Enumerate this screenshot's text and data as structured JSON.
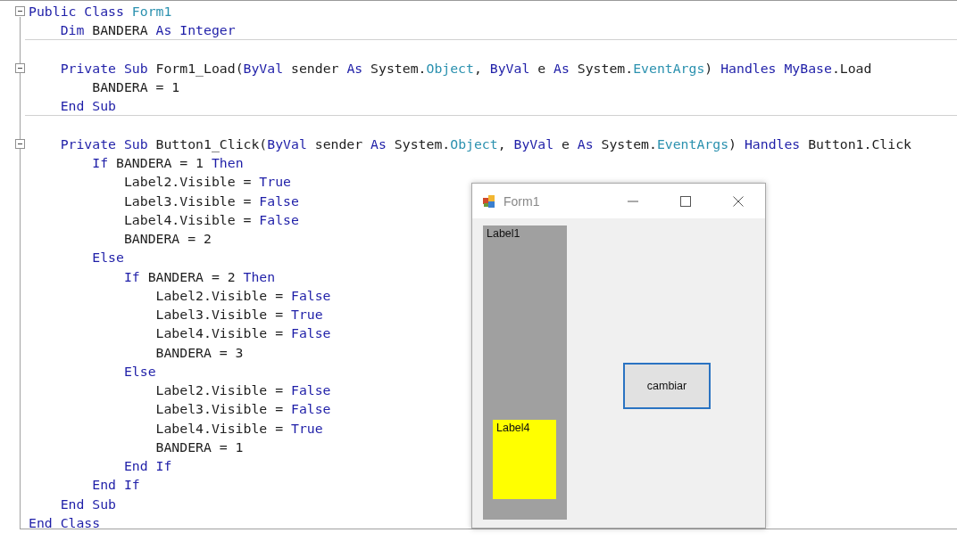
{
  "code_lines": [
    {
      "kind": "code",
      "expanded": true,
      "tokens": [
        {
          "kind": "kw",
          "text": "Public Class "
        },
        {
          "kind": "type",
          "text": "Form1"
        }
      ]
    },
    {
      "kind": "code",
      "separator_after": true,
      "tokens": [
        {
          "kind": "kw",
          "text": "    Dim"
        },
        {
          "kind": "plain",
          "text": " BANDERA "
        },
        {
          "kind": "kw",
          "text": "As Integer"
        }
      ]
    },
    {
      "kind": "blank"
    },
    {
      "kind": "code",
      "expanded": true,
      "tokens": [
        {
          "kind": "kw",
          "text": "    Private Sub"
        },
        {
          "kind": "plain",
          "text": " Form1_Load("
        },
        {
          "kind": "kw",
          "text": "ByVal"
        },
        {
          "kind": "plain",
          "text": " sender "
        },
        {
          "kind": "kw",
          "text": "As"
        },
        {
          "kind": "plain",
          "text": " System."
        },
        {
          "kind": "type",
          "text": "Object"
        },
        {
          "kind": "plain",
          "text": ", "
        },
        {
          "kind": "kw",
          "text": "ByVal"
        },
        {
          "kind": "plain",
          "text": " e "
        },
        {
          "kind": "kw",
          "text": "As"
        },
        {
          "kind": "plain",
          "text": " System."
        },
        {
          "kind": "type",
          "text": "EventArgs"
        },
        {
          "kind": "plain",
          "text": ") "
        },
        {
          "kind": "kw",
          "text": "Handles MyBase"
        },
        {
          "kind": "plain",
          "text": ".Load"
        }
      ]
    },
    {
      "kind": "code",
      "tokens": [
        {
          "kind": "plain",
          "text": "        BANDERA = 1"
        }
      ]
    },
    {
      "kind": "code",
      "separator_after": true,
      "tokens": [
        {
          "kind": "kw",
          "text": "    End Sub"
        }
      ]
    },
    {
      "kind": "blank"
    },
    {
      "kind": "code",
      "expanded": true,
      "tokens": [
        {
          "kind": "kw",
          "text": "    Private Sub"
        },
        {
          "kind": "plain",
          "text": " Button1_Click("
        },
        {
          "kind": "kw",
          "text": "ByVal"
        },
        {
          "kind": "plain",
          "text": " sender "
        },
        {
          "kind": "kw",
          "text": "As"
        },
        {
          "kind": "plain",
          "text": " System."
        },
        {
          "kind": "type",
          "text": "Object"
        },
        {
          "kind": "plain",
          "text": ", "
        },
        {
          "kind": "kw",
          "text": "ByVal"
        },
        {
          "kind": "plain",
          "text": " e "
        },
        {
          "kind": "kw",
          "text": "As"
        },
        {
          "kind": "plain",
          "text": " System."
        },
        {
          "kind": "type",
          "text": "EventArgs"
        },
        {
          "kind": "plain",
          "text": ") "
        },
        {
          "kind": "kw",
          "text": "Handles"
        },
        {
          "kind": "plain",
          "text": " Button1.Click"
        }
      ]
    },
    {
      "kind": "code",
      "tokens": [
        {
          "kind": "kw",
          "text": "        If"
        },
        {
          "kind": "plain",
          "text": " BANDERA = 1 "
        },
        {
          "kind": "kw",
          "text": "Then"
        }
      ]
    },
    {
      "kind": "code",
      "tokens": [
        {
          "kind": "plain",
          "text": "            Label2.Visible = "
        },
        {
          "kind": "kw",
          "text": "True"
        }
      ]
    },
    {
      "kind": "code",
      "tokens": [
        {
          "kind": "plain",
          "text": "            Label3.Visible = "
        },
        {
          "kind": "kw",
          "text": "False"
        }
      ]
    },
    {
      "kind": "code",
      "tokens": [
        {
          "kind": "plain",
          "text": "            Label4.Visible = "
        },
        {
          "kind": "kw",
          "text": "False"
        }
      ]
    },
    {
      "kind": "code",
      "tokens": [
        {
          "kind": "plain",
          "text": "            BANDERA = 2"
        }
      ]
    },
    {
      "kind": "code",
      "tokens": [
        {
          "kind": "kw",
          "text": "        Else"
        }
      ]
    },
    {
      "kind": "code",
      "tokens": [
        {
          "kind": "kw",
          "text": "            If"
        },
        {
          "kind": "plain",
          "text": " BANDERA = 2 "
        },
        {
          "kind": "kw",
          "text": "Then"
        }
      ]
    },
    {
      "kind": "code",
      "tokens": [
        {
          "kind": "plain",
          "text": "                Label2.Visible = "
        },
        {
          "kind": "kw",
          "text": "False"
        }
      ]
    },
    {
      "kind": "code",
      "tokens": [
        {
          "kind": "plain",
          "text": "                Label3.Visible = "
        },
        {
          "kind": "kw",
          "text": "True"
        }
      ]
    },
    {
      "kind": "code",
      "tokens": [
        {
          "kind": "plain",
          "text": "                Label4.Visible = "
        },
        {
          "kind": "kw",
          "text": "False"
        }
      ]
    },
    {
      "kind": "code",
      "tokens": [
        {
          "kind": "plain",
          "text": "                BANDERA = 3"
        }
      ]
    },
    {
      "kind": "code",
      "tokens": [
        {
          "kind": "kw",
          "text": "            Else"
        }
      ]
    },
    {
      "kind": "code",
      "tokens": [
        {
          "kind": "plain",
          "text": "                Label2.Visible = "
        },
        {
          "kind": "kw",
          "text": "False"
        }
      ]
    },
    {
      "kind": "code",
      "tokens": [
        {
          "kind": "plain",
          "text": "                Label3.Visible = "
        },
        {
          "kind": "kw",
          "text": "False"
        }
      ]
    },
    {
      "kind": "code",
      "tokens": [
        {
          "kind": "plain",
          "text": "                Label4.Visible = "
        },
        {
          "kind": "kw",
          "text": "True"
        }
      ]
    },
    {
      "kind": "code",
      "tokens": [
        {
          "kind": "plain",
          "text": "                BANDERA = 1"
        }
      ]
    },
    {
      "kind": "code",
      "tokens": [
        {
          "kind": "kw",
          "text": "            End If"
        }
      ]
    },
    {
      "kind": "code",
      "tokens": [
        {
          "kind": "kw",
          "text": "        End If"
        }
      ]
    },
    {
      "kind": "code",
      "tokens": [
        {
          "kind": "kw",
          "text": "    End Sub"
        }
      ]
    },
    {
      "kind": "code",
      "tokens": [
        {
          "kind": "kw",
          "text": "End Class"
        }
      ]
    }
  ],
  "form_window": {
    "title": "Form1",
    "label_1": {
      "text": "Label1",
      "color": "#a0a0a0"
    },
    "label_4": {
      "text": "Label4",
      "color": "#ffff00"
    },
    "button": {
      "label": "cambiar",
      "focused": true
    }
  }
}
